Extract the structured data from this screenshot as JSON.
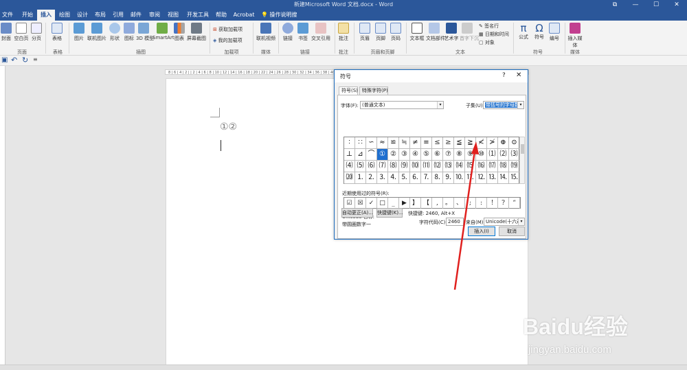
{
  "window": {
    "title": "新建Microsoft Word 文档.docx  -  Word",
    "controls": [
      "⧉",
      "—",
      "☐",
      "✕"
    ]
  },
  "tabs": [
    "文件",
    "开始",
    "插入",
    "绘图",
    "设计",
    "布局",
    "引用",
    "邮件",
    "审阅",
    "视图",
    "开发工具",
    "帮助",
    "Acrobat",
    "操作说明搜索"
  ],
  "ribbon": {
    "buttons": [
      "封面",
      "空白页",
      "分页",
      "表格",
      "图片",
      "联机图片",
      "形状",
      "图标",
      "3D 模型",
      "SmartArt",
      "图表",
      "屏幕截图",
      "获取加载项",
      "我的加载项",
      "联机视频",
      "链接",
      "书签",
      "交叉引用",
      "批注",
      "页眉",
      "页脚",
      "页码",
      "文本框",
      "文档部件",
      "艺术字",
      "首字下沉",
      "签名行",
      "日期和时间",
      "对象",
      "公式",
      "符号",
      "编号",
      "插入媒体"
    ],
    "groups": [
      "页面",
      "表格",
      "插图",
      "加载项",
      "媒体",
      "链接",
      "批注",
      "页眉和页脚",
      "文本",
      "符号",
      "媒体"
    ]
  },
  "ruler": {
    "marks": "8 | 6 | 4 | 2 | | 2 | 4 | 6 | 8 | 10 | 12 | 14 | 16 | 18 | 20 | 22 | 24 | 26 | 28 | 30 | 32 | 34 | 36 | 38 | 40 | 42 | 44 | 46 | 48"
  },
  "document": {
    "text": "①②"
  },
  "dialog": {
    "title": "符号",
    "help": "?",
    "close": "✕",
    "tabs": [
      "符号(S)",
      "特殊字符(P)"
    ],
    "font_label": "字体(F):",
    "font_value": "(普通文本)",
    "subset_label": "子集(U):",
    "subset_value": "带括号的字母数字",
    "symbols": [
      "∶",
      "∷",
      "∽",
      "≈",
      "≌",
      "≒",
      "≠",
      "≡",
      "≤",
      "≥",
      "≦",
      "≧",
      "≮",
      "≯",
      "⊕",
      "⊙",
      "⊥",
      "⊿",
      "⌒",
      "①",
      "②",
      "③",
      "④",
      "⑤",
      "⑥",
      "⑦",
      "⑧",
      "⑨",
      "⑩",
      "⑴",
      "⑵",
      "⑶",
      "⑷",
      "⑸",
      "⑹",
      "⑺",
      "⑻",
      "⑼",
      "⑽",
      "⑾",
      "⑿",
      "⒀",
      "⒁",
      "⒂",
      "⒃",
      "⒄",
      "⒅",
      "⒆",
      "⒇",
      "⒈",
      "⒉",
      "⒊",
      "⒋",
      "⒌",
      "⒍",
      "⒎",
      "⒏",
      "⒐",
      "⒑",
      "⒒",
      "⒓",
      "⒔",
      "⒕",
      "⒖"
    ],
    "selected_symbol": "①",
    "recent_label": "近期使用过的符号(R):",
    "recent": [
      "☑",
      "☒",
      "✓",
      "□",
      "_",
      "▶",
      "】",
      "【",
      ",",
      "。",
      "、",
      ";",
      ":",
      "!",
      "?",
      "“"
    ],
    "unicode_name_label": "Unicode 名称:",
    "unicode_name": "带圆圈数字一",
    "char_code_label": "字符代码(C):",
    "char_code": "2460",
    "from_label": "来自(M):",
    "from_value": "Unicode(十六进制)",
    "autocorrect_btn": "自动更正(A)...",
    "shortcut_btn": "快捷键(K)...",
    "shortcut_text": "快捷键: 2460, Alt+X",
    "insert_btn": "插入(I)",
    "cancel_btn": "取消"
  },
  "watermark": {
    "brand": "Baidu经验",
    "url": "jingyan.baidu.com"
  },
  "colors": {
    "accent": "#2b579a",
    "arrow": "#e0201e",
    "selection": "#1f6fcf"
  }
}
